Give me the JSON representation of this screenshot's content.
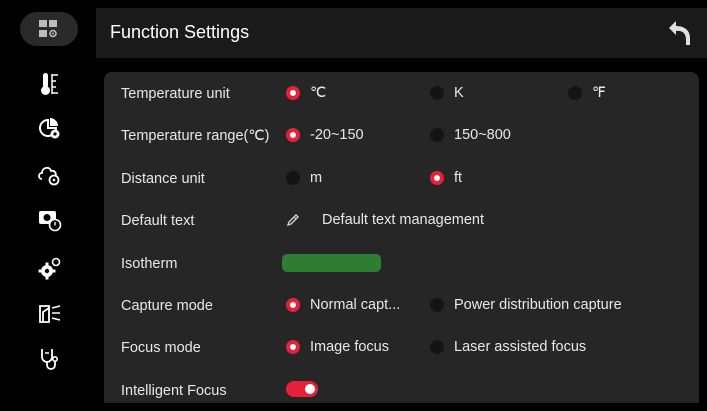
{
  "header": {
    "title": "Function Settings"
  },
  "colors": {
    "accent": "#e8213a",
    "isotherm": "#2f7d32",
    "toggle_on": "#e8213a"
  },
  "sidebar": {
    "items": [
      {
        "icon": "grid-settings-icon",
        "active": true
      },
      {
        "icon": "thermometer-icon",
        "active": false
      },
      {
        "icon": "pie-chart-gear-icon",
        "active": false
      },
      {
        "icon": "cloud-gear-icon",
        "active": false
      },
      {
        "icon": "camera-timer-icon",
        "active": false
      },
      {
        "icon": "gears-icon",
        "active": false
      },
      {
        "icon": "laser-device-icon",
        "active": false
      },
      {
        "icon": "stethoscope-icon",
        "active": false
      }
    ]
  },
  "settings": {
    "temperature_unit": {
      "label": "Temperature unit",
      "options": [
        "℃",
        "K",
        "℉"
      ],
      "selected": "℃"
    },
    "temperature_range": {
      "label": "Temperature range(℃)",
      "options": [
        "-20~150",
        "150~800"
      ],
      "selected": "-20~150"
    },
    "distance_unit": {
      "label": "Distance unit",
      "options": [
        "m",
        "ft"
      ],
      "selected": "ft"
    },
    "default_text": {
      "label": "Default text",
      "action": "Default text management"
    },
    "isotherm": {
      "label": "Isotherm"
    },
    "capture_mode": {
      "label": "Capture mode",
      "options": [
        "Normal capt...",
        "Power distribution capture"
      ],
      "selected": "Normal capt..."
    },
    "focus_mode": {
      "label": "Focus mode",
      "options": [
        "Image focus",
        "Laser assisted focus"
      ],
      "selected": "Image focus"
    },
    "intelligent_focus": {
      "label": "Intelligent Focus",
      "enabled": true
    }
  }
}
